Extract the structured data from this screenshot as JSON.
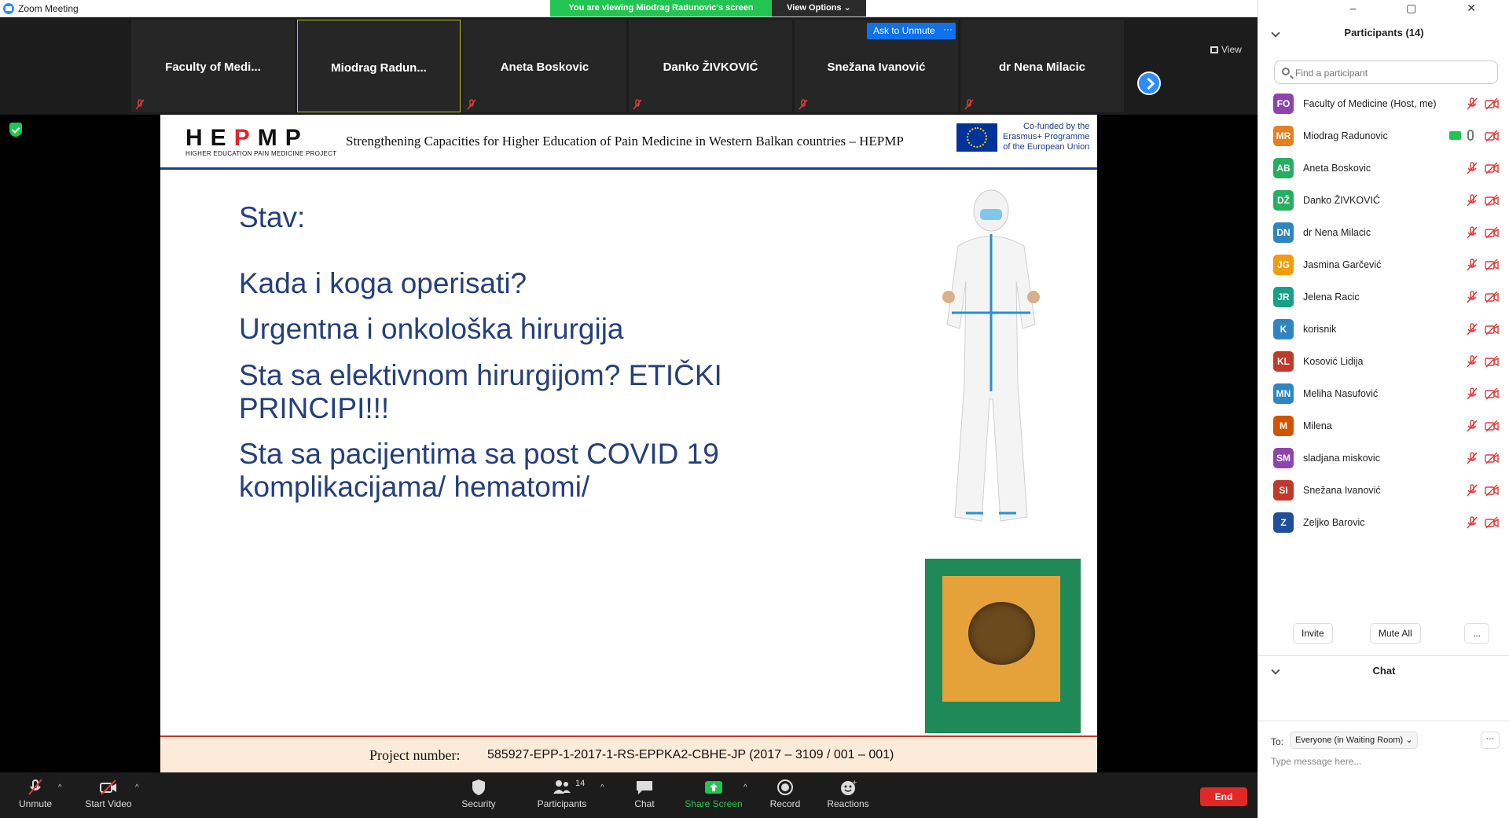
{
  "window": {
    "title": "Zoom Meeting",
    "viewing_banner": "You are viewing Miodrag Radunovic's screen",
    "view_options": "View Options ⌄",
    "view_label": "View",
    "controls": "–  ▢  ✕"
  },
  "tiles": [
    {
      "name": "Faculty  of  Medi...",
      "active": false
    },
    {
      "name": "Miodrag  Radun...",
      "active": true
    },
    {
      "name": "Aneta Boskovic",
      "active": false
    },
    {
      "name": "Danko ŽIVKOVIĆ",
      "active": false
    },
    {
      "name": "Snežana Ivanović",
      "active": false
    },
    {
      "name": "dr Nena Milacic",
      "active": false
    }
  ],
  "tile_actions": {
    "ask_to_unmute": "Ask to Unmute",
    "more": "···"
  },
  "slide": {
    "logo_letters_a": "HE",
    "logo_letters_b": "P",
    "logo_letters_c": "MP",
    "logo_sub": "HIGHER EDUCATION PAIN MEDICINE PROJECT",
    "title": "Strengthening Capacities for Higher Education of Pain Medicine in Western Balkan countries – HEPMP",
    "eu_line1": "Co-funded by the",
    "eu_line2": "Erasmus+ Programme",
    "eu_line3": "of the European Union",
    "bullets": [
      "Stav:",
      "Kada i koga operisati?",
      "Urgentna i onkološka hirurgija",
      "Sta sa elektivnom hirurgijom? ETIČKI",
      "PRINCIPI!!!",
      "Sta sa pacijentima sa post COVID 19",
      "komplikacijama/ hematomi/"
    ],
    "footer_label": "Project number:",
    "footer_value": "585927-EPP-1-2017-1-RS-EPPKA2-CBHE-JP (2017 – 3109 / 001 – 001)"
  },
  "toolbar": {
    "unmute": "Unmute",
    "start_video": "Start Video",
    "security": "Security",
    "participants": "Participants",
    "participants_count": "14",
    "chat": "Chat",
    "share_screen": "Share Screen",
    "record": "Record",
    "reactions": "Reactions",
    "end": "End",
    "caret": "^"
  },
  "panel": {
    "title": "Participants (14)",
    "search_placeholder": "Find a participant",
    "participants": [
      {
        "initials": "FO",
        "name": "Faculty of Medicine (Host, me)",
        "color": "#8e44ad"
      },
      {
        "initials": "MR",
        "name": "Miodrag Radunovic",
        "color": "#e67e22"
      },
      {
        "initials": "AB",
        "name": "Aneta Boskovic",
        "color": "#27ae60"
      },
      {
        "initials": "DŽ",
        "name": "Danko ŽIVKOVIĆ",
        "color": "#27ae60"
      },
      {
        "initials": "DN",
        "name": "dr Nena Milacic",
        "color": "#2e86c1"
      },
      {
        "initials": "JG",
        "name": "Jasmina Garčević",
        "color": "#f39c12"
      },
      {
        "initials": "JR",
        "name": "Jelena Racic",
        "color": "#16a085"
      },
      {
        "initials": "K",
        "name": "korisnik",
        "color": "#2e86c1"
      },
      {
        "initials": "KL",
        "name": "Kosović Lidija",
        "color": "#c0392b"
      },
      {
        "initials": "MN",
        "name": "Meliha Nasufović",
        "color": "#2e86c1"
      },
      {
        "initials": "M",
        "name": "Milena",
        "color": "#d35400"
      },
      {
        "initials": "SM",
        "name": "sladjana miskovic",
        "color": "#8e44ad"
      },
      {
        "initials": "SI",
        "name": "Snežana Ivanović",
        "color": "#c0392b"
      },
      {
        "initials": "Z",
        "name": "Zeljko Barovic",
        "color": "#1f4e9c"
      }
    ],
    "invite": "Invite",
    "mute_all": "Mute All",
    "more": "...",
    "chat_title": "Chat",
    "to_label": "To:",
    "to_value": "Everyone (in Waiting Room) ⌄",
    "chat_more": "···",
    "chat_placeholder": "Type message here..."
  },
  "colors": {
    "accent": "#2d8cff",
    "share_green": "#23c552",
    "end_red": "#e02828",
    "slide_text": "#25407a",
    "muted_red": "#e03a3a"
  }
}
